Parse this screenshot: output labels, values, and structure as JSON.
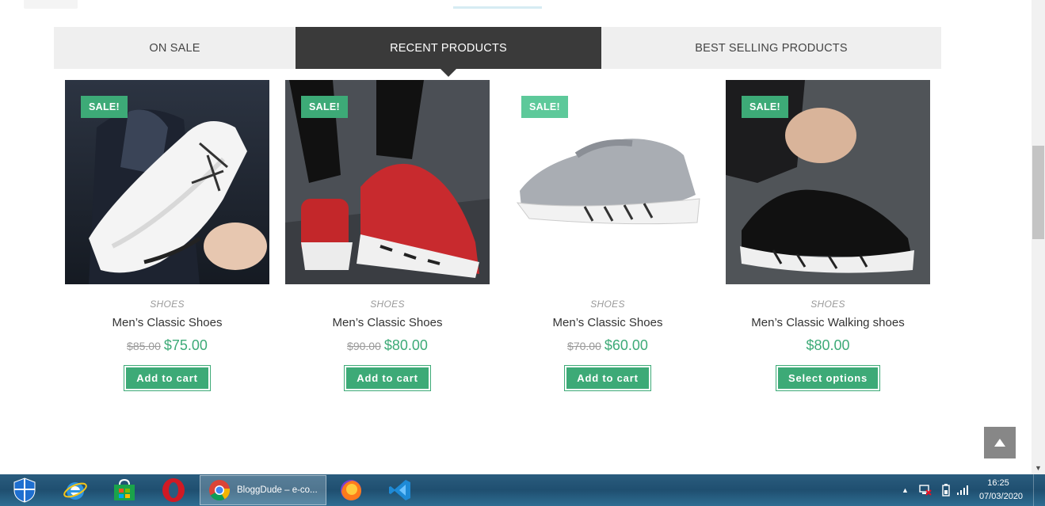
{
  "tabs": [
    {
      "label": "ON SALE"
    },
    {
      "label": "RECENT PRODUCTS"
    },
    {
      "label": "BEST SELLING PRODUCTS"
    }
  ],
  "products": [
    {
      "sale_badge": "SALE!",
      "category": "SHOES",
      "name": "Men’s Classic Shoes",
      "old_price": "$85.00",
      "price": "$75.00",
      "button": "Add to cart"
    },
    {
      "sale_badge": "SALE!",
      "category": "SHOES",
      "name": "Men’s Classic Shoes",
      "old_price": "$90.00",
      "price": "$80.00",
      "button": "Add to cart"
    },
    {
      "sale_badge": "SALE!",
      "category": "SHOES",
      "name": "Men’s Classic Shoes",
      "old_price": "$70.00",
      "price": "$60.00",
      "button": "Add to cart"
    },
    {
      "sale_badge": "SALE!",
      "category": "SHOES",
      "name": "Men’s Classic Walking shoes",
      "old_price": "",
      "price": "$80.00",
      "button": "Select options"
    }
  ],
  "taskbar": {
    "active_task_label": "BloggDude – e-co...",
    "clock_time": "16:25",
    "clock_date": "07/03/2020",
    "icons": [
      "windows-defender-icon",
      "internet-explorer-icon",
      "store-icon",
      "opera-icon",
      "chrome-icon",
      "firefox-icon",
      "vscode-icon"
    ]
  },
  "colors": {
    "accent_green": "#3daa77",
    "tab_active_bg": "#3a3a3a",
    "tab_bar_bg": "#efefef",
    "taskbar": "#245a7c"
  }
}
